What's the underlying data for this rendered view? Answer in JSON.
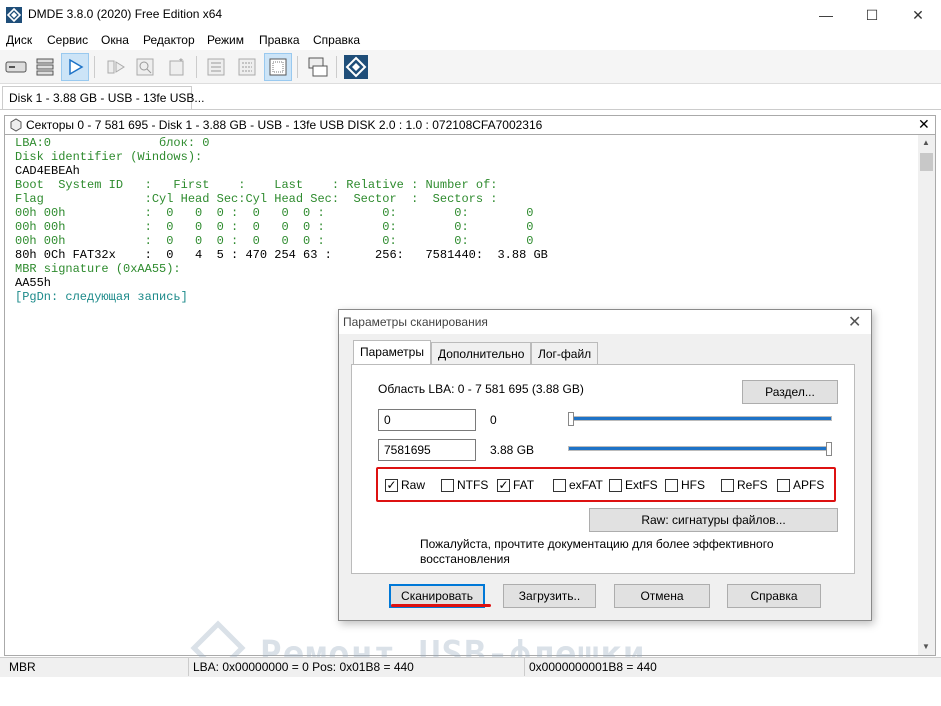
{
  "window": {
    "title": "DMDE 3.8.0 (2020) Free Edition x64",
    "minimize_glyph": "—",
    "maximize_glyph": "☐",
    "close_glyph": "✕"
  },
  "menu": [
    "Диск",
    "Сервис",
    "Окна",
    "Редактор",
    "Режим",
    "Правка",
    "Справка"
  ],
  "toolbar": {
    "icons": [
      "drive-icon",
      "partitions-icon",
      "play-icon",
      "forward-icon",
      "scan-icon",
      "new-icon",
      "table-icon",
      "list-icon",
      "grid-icon",
      "copy-icon",
      "dmde-logo-icon"
    ]
  },
  "disk_tab": {
    "label": "Disk 1 - 3.88 GB - USB - 13fe USB..."
  },
  "sector_panel": {
    "header": "Секторы 0 - 7 581 695 - Disk 1 - 3.88 GB - USB - 13fe USB DISK 2.0 : 1.0 : 072108CFA7002316",
    "close_glyph": "✕",
    "lines": [
      {
        "text": "LBA:0               блок: 0",
        "color": "green"
      },
      {
        "text": "Disk identifier (Windows):",
        "color": "green"
      },
      {
        "text": "CAD4EBEAh",
        "color": "dark"
      },
      {
        "text": "Boot  System ID   :   First    :    Last    : Relative : Number of:",
        "color": "green"
      },
      {
        "text": "Flag              :Cyl Head Sec:Cyl Head Sec:  Sector  :  Sectors :",
        "color": "green"
      },
      {
        "text": "00h 00h           :  0   0  0 :  0   0  0 :        0:        0:        0",
        "color": "green"
      },
      {
        "text": "00h 00h           :  0   0  0 :  0   0  0 :        0:        0:        0",
        "color": "green"
      },
      {
        "text": "00h 00h           :  0   0  0 :  0   0  0 :        0:        0:        0",
        "color": "green"
      },
      {
        "text": "80h 0Ch FAT32x    :  0   4  5 : 470 254 63 :      256:   7581440:  3.88 GB",
        "color": "dark"
      },
      {
        "text": "MBR signature (0xAA55):",
        "color": "green"
      },
      {
        "text": "AA55h",
        "color": "dark"
      },
      {
        "text": "[PgDn: следующая запись]",
        "color": "teal"
      }
    ]
  },
  "status": {
    "left": "MBR",
    "middle": "LBA: 0x00000000 = 0  Pos: 0x01B8 = 440",
    "right": "0x0000000001B8 = 440"
  },
  "watermark": "Ремонт USB-флешки",
  "dialog": {
    "title": "Параметры сканирования",
    "close_glyph": "✕",
    "tabs": [
      "Параметры",
      "Дополнительно",
      "Лог-файл"
    ],
    "lba_area": "Область LBA: 0 - 7 581 695 (3.88 GB)",
    "partition_button": "Раздел...",
    "start_value": "0",
    "start_label": "0",
    "end_value": "7581695",
    "end_label": "3.88 GB",
    "start_slider_fraction": 0.0,
    "end_slider_fraction": 1.0,
    "filesystems": [
      {
        "name": "Raw",
        "checked": true
      },
      {
        "name": "NTFS",
        "checked": false
      },
      {
        "name": "FAT",
        "checked": true
      },
      {
        "name": "exFAT",
        "checked": false
      },
      {
        "name": "ExtFS",
        "checked": false
      },
      {
        "name": "HFS",
        "checked": false
      },
      {
        "name": "ReFS",
        "checked": false
      },
      {
        "name": "APFS",
        "checked": false
      }
    ],
    "raw_signatures_button": "Raw: сигнатуры файлов...",
    "note_line1": "Пожалуйста, прочтите документацию для более эффективного",
    "note_line2": "восстановления",
    "buttons": {
      "scan": "Сканировать",
      "load": "Загрузить..",
      "cancel": "Отмена",
      "help": "Справка"
    },
    "highlight_color": "#dd1111"
  }
}
